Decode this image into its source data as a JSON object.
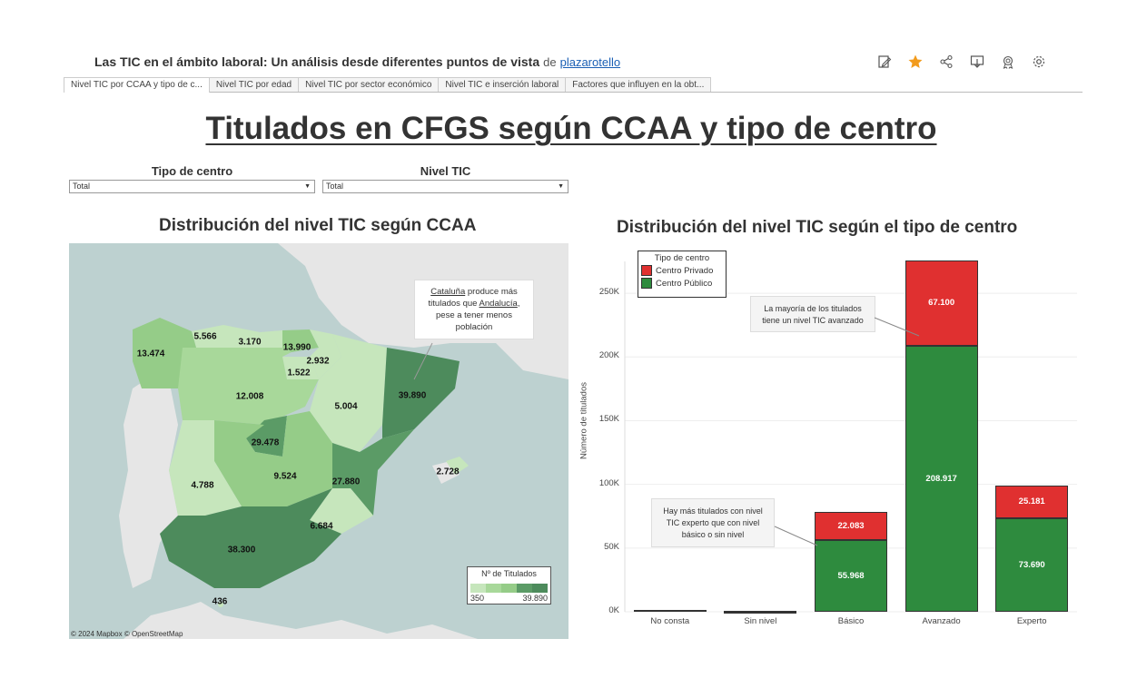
{
  "header": {
    "title": "Las TIC en el ámbito laboral: Un análisis desde diferentes puntos de vista",
    "by": "de",
    "author": "plazarotello"
  },
  "toolbar": {
    "icons": [
      "edit-icon",
      "star-icon",
      "share-icon",
      "download-icon",
      "badge-icon",
      "settings-icon"
    ]
  },
  "tabs": [
    {
      "label": "Nivel TIC por CCAA y tipo de c..."
    },
    {
      "label": "Nivel TIC por edad"
    },
    {
      "label": "Nivel TIC por sector económico"
    },
    {
      "label": "Nivel TIC e inserción laboral"
    },
    {
      "label": "Factores que influyen en la obt..."
    }
  ],
  "page_title": "Titulados en CFGS según CCAA y tipo de centro",
  "filters": {
    "tipo_centro": {
      "label": "Tipo de centro",
      "value": "Total"
    },
    "nivel_tic": {
      "label": "Nivel TIC",
      "value": "Total"
    }
  },
  "map": {
    "title": "Distribución del nivel TIC según CCAA",
    "annotation": {
      "line1a": "Cataluña",
      "line1b": " produce más",
      "line2a": "titulados que ",
      "line2b": "Andalucía",
      "line2c": ",",
      "line3": "pese a tener menos",
      "line4": "población"
    },
    "values": {
      "galicia": "13.474",
      "asturias": "5.566",
      "cantabria": "3.170",
      "pais_vasco": "13.990",
      "navarra": "2.932",
      "la_rioja": "1.522",
      "castilla_leon": "12.008",
      "aragon": "5.004",
      "cataluna": "39.890",
      "madrid": "29.478",
      "castilla_la_mancha": "9.524",
      "extremadura": "4.788",
      "valencia": "27.880",
      "baleares": "2.728",
      "murcia": "6.684",
      "andalucia": "38.300",
      "ceuta": "436"
    },
    "legend": {
      "title": "Nº de Titulados",
      "min": "350",
      "max": "39.890"
    },
    "attribution": "© 2024 Mapbox  © OpenStreetMap"
  },
  "chart_data": {
    "type": "bar",
    "title": "Distribución del nivel TIC según el tipo de centro",
    "xlabel": "",
    "ylabel": "Número de titulados",
    "categories": [
      "No consta",
      "Sin nivel",
      "Básico",
      "Avanzado",
      "Experto"
    ],
    "series": [
      {
        "name": "Centro Público",
        "values": [
          1200,
          300,
          55968,
          208917,
          73690
        ],
        "labels": [
          "",
          "",
          "55.968",
          "208.917",
          "73.690"
        ],
        "color": "#2e8b3e"
      },
      {
        "name": "Centro Privado",
        "values": [
          300,
          100,
          22083,
          67100,
          25181
        ],
        "labels": [
          "",
          "",
          "22.083",
          "67.100",
          "25.181"
        ],
        "color": "#e03030"
      }
    ],
    "ylim": [
      0,
      275000
    ],
    "yticks": [
      0,
      50000,
      100000,
      150000,
      200000,
      250000
    ],
    "ytick_labels": [
      "0K",
      "50K",
      "100K",
      "150K",
      "200K",
      "250K"
    ],
    "legend_title": "Tipo de centro",
    "legend_position": "top-left",
    "annotations": {
      "avanzado": [
        "La mayoría de los titulados",
        "tiene un nivel TIC avanzado"
      ],
      "experto": [
        "Hay más titulados con nivel",
        "TIC experto que con nivel",
        "básico o sin nivel"
      ]
    }
  }
}
